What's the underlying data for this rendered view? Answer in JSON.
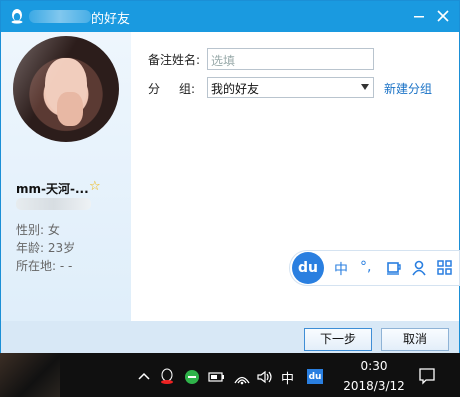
{
  "window": {
    "title_suffix": "的好友",
    "minimize_icon": "minimize-icon",
    "close_icon": "close-icon"
  },
  "profile": {
    "nickname": "mm-天河-...",
    "gender": "性别: 女",
    "age": "年龄: 23岁",
    "location": "所在地: -     -"
  },
  "form": {
    "remark_label": "备注姓名:",
    "remark_placeholder": "选填",
    "group_label_a": "分",
    "group_label_b": "组:",
    "group_value": "我的好友",
    "new_group_link": "新建分组"
  },
  "buttons": {
    "next": "下一步",
    "cancel": "取消"
  },
  "ime_toolbar": {
    "logo": "du",
    "mode": "中",
    "punct": "°,",
    "items": [
      "cup-icon",
      "person-icon",
      "grid-icon"
    ]
  },
  "taskbar": {
    "ime_label": "中",
    "du_label": "du",
    "time": "0:30",
    "date": "2018/3/12"
  },
  "colors": {
    "accent": "#1a9ae0",
    "link": "#1a72c6",
    "ime_blue": "#2a7fe0"
  }
}
